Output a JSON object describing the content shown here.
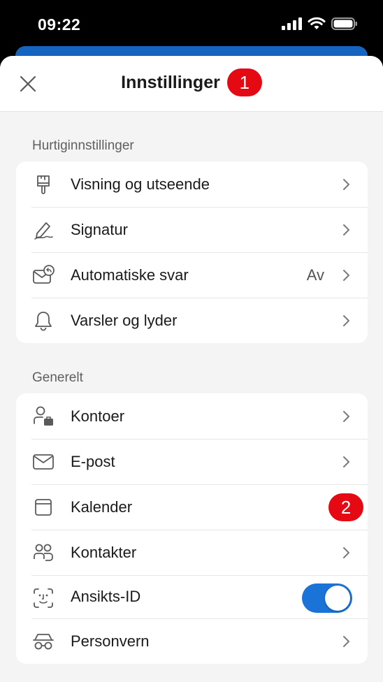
{
  "status_bar": {
    "time": "09:22"
  },
  "header": {
    "title": "Innstillinger",
    "marker": "1",
    "close_icon": "close-icon"
  },
  "quick_settings": {
    "label": "Hurtiginnstillinger",
    "items": [
      {
        "label": "Visning og utseende",
        "icon": "paintbrush-icon"
      },
      {
        "label": "Signatur",
        "icon": "signature-pen-icon"
      },
      {
        "label": "Automatiske svar",
        "value": "Av",
        "icon": "auto-reply-mail-icon"
      },
      {
        "label": "Varsler og lyder",
        "icon": "bell-icon"
      }
    ]
  },
  "general": {
    "label": "Generelt",
    "items": [
      {
        "label": "Kontoer",
        "icon": "account-briefcase-icon"
      },
      {
        "label": "E-post",
        "icon": "mail-icon"
      },
      {
        "label": "Kalender",
        "icon": "calendar-icon",
        "marker": "2"
      },
      {
        "label": "Kontakter",
        "icon": "contacts-icon"
      },
      {
        "label": "Ansikts-ID",
        "icon": "face-id-icon",
        "toggle_on": true
      },
      {
        "label": "Personvern",
        "icon": "incognito-icon"
      }
    ]
  },
  "colors": {
    "accent": "#1a73d6",
    "marker": "#e50914",
    "banner": "#1565c0"
  }
}
